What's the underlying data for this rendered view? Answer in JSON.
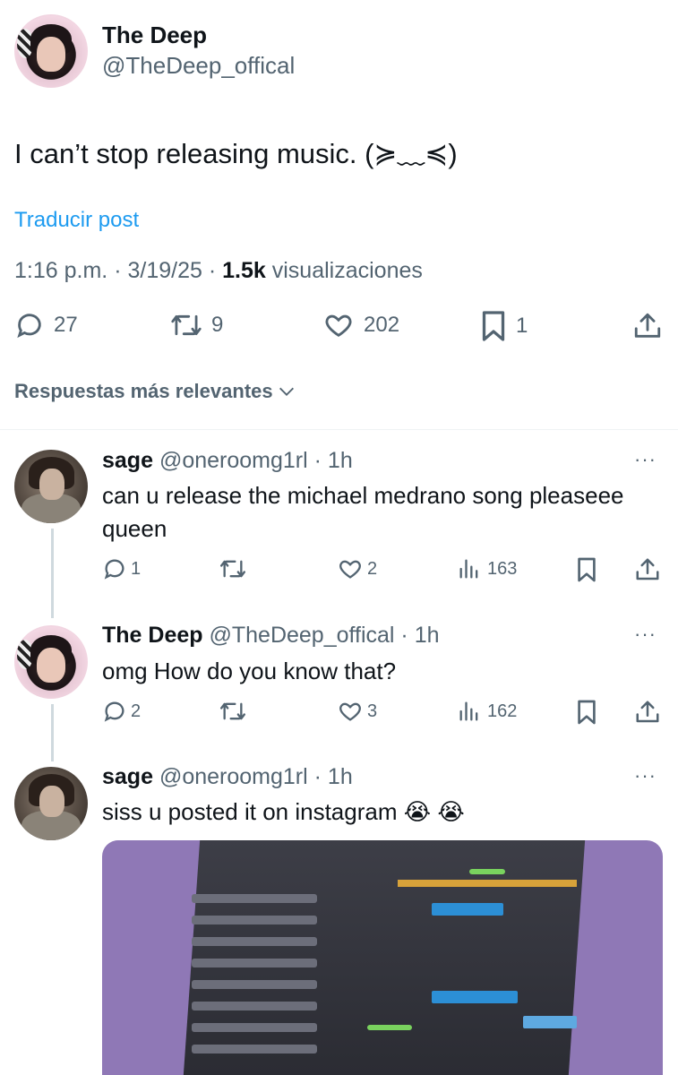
{
  "post": {
    "author_name": "The Deep",
    "author_handle": "@TheDeep_offical",
    "text": "I can’t stop releasing music. (≽﹏≼)",
    "translate_label": "Traducir post",
    "time": "1:16 p.m.",
    "date": "3/19/25",
    "views_count": "1.5k",
    "views_label": "visualizaciones",
    "replies": "27",
    "reposts": "9",
    "likes": "202",
    "bookmarks": "1"
  },
  "sort_label": "Respuestas más relevantes",
  "replies": [
    {
      "name": "sage",
      "handle": "@oneroomg1rl",
      "age": "1h",
      "text_line1": "can u release the michael medrano song pleaseee",
      "text_line2": "queen",
      "replies": "1",
      "reposts": "",
      "likes": "2",
      "views": "163"
    },
    {
      "name": "The Deep",
      "handle": "@TheDeep_offical",
      "age": "1h",
      "text_line1": "omg How do you know that?",
      "replies": "2",
      "reposts": "",
      "likes": "3",
      "views": "162"
    },
    {
      "name": "sage",
      "handle": "@oneroomg1rl",
      "age": "1h",
      "text_line1": "siss u posted it on instagram 😭 😭"
    }
  ],
  "colors": {
    "accent": "#1d9bf0",
    "muted": "#536471",
    "text": "#0f1419"
  },
  "icons": [
    "reply-icon",
    "repost-icon",
    "like-icon",
    "bookmark-icon",
    "share-icon",
    "views-icon",
    "more-icon",
    "chevron-down-icon"
  ]
}
